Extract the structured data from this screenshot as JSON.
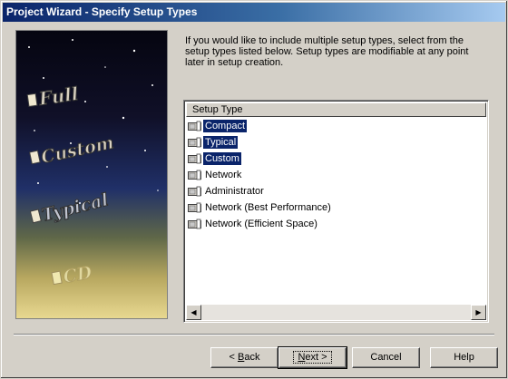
{
  "window": {
    "title": "Project Wizard - Specify Setup Types"
  },
  "image_panel": {
    "labels": [
      "Full",
      "Custom",
      "Typical",
      "CD"
    ]
  },
  "intro_text": "If you would like to include multiple setup types, select from the setup types listed below.  Setup types are modifiable at any point later in setup creation.",
  "setup_list": {
    "column_header": "Setup Type",
    "items": [
      {
        "label": "Compact",
        "selected": true
      },
      {
        "label": "Typical",
        "selected": true
      },
      {
        "label": "Custom",
        "selected": true
      },
      {
        "label": "Network",
        "selected": false
      },
      {
        "label": "Administrator",
        "selected": false
      },
      {
        "label": "Network (Best Performance)",
        "selected": false
      },
      {
        "label": "Network (Efficient Space)",
        "selected": false
      }
    ]
  },
  "buttons": {
    "back_pre": "< ",
    "back_mnemonic": "B",
    "back_post": "ack",
    "next_mnemonic": "N",
    "next_post": "ext >",
    "cancel": "Cancel",
    "help": "Help"
  }
}
